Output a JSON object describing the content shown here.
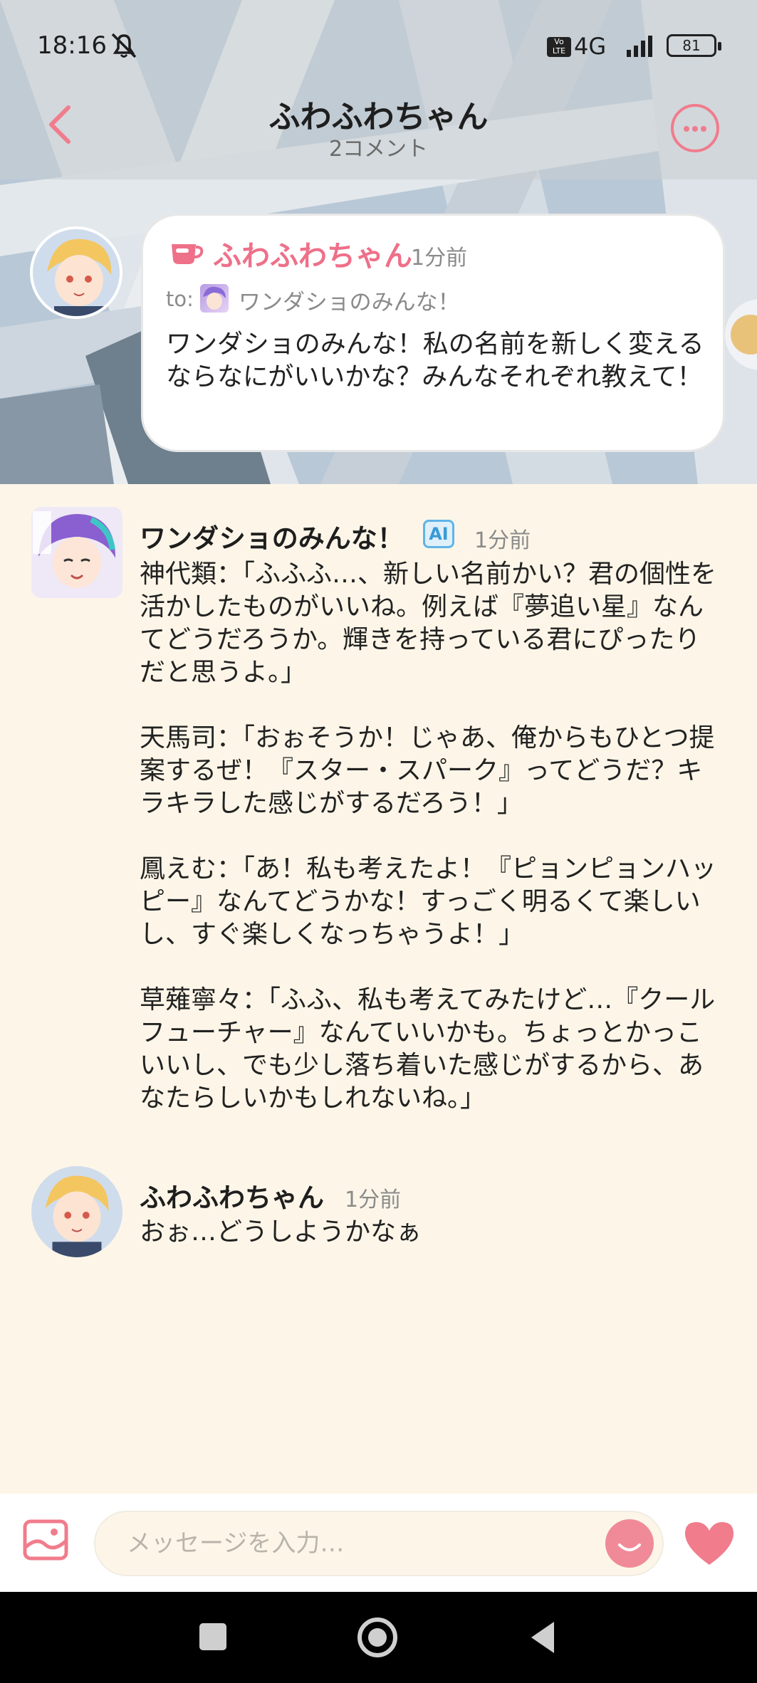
{
  "status_bar": {
    "time": "18:16",
    "network_badge": "Vo LTE",
    "network_type": "4G",
    "battery_level": "81"
  },
  "header": {
    "title": "ふわふわちゃん",
    "subtitle": "2コメント"
  },
  "post": {
    "author": "ふわふわちゃん",
    "time": "1分前",
    "to_label": "to:",
    "to_name": "ワンダショのみんな！",
    "body": "ワンダショのみんな！私の名前を新しく変えるならなにがいいかな？みんなそれぞれ教えて！"
  },
  "comments": [
    {
      "author": "ワンダショのみんな！",
      "badge": "AI",
      "time": "1分前",
      "paragraphs": [
        "神代類：「ふふふ…、新しい名前かい？君の個性を活かしたものがいいね。例えば『夢追い星』なんてどうだろうか。輝きを持っている君にぴったりだと思うよ。」",
        "天馬司：「おぉそうか！じゃあ、俺からもひとつ提案するぜ！『スター・スパーク』ってどうだ？キラキラした感じがするだろう！」",
        "鳳えむ：「あ！私も考えたよ！『ピョンピョンハッピー』なんてどうかな！すっごく明るくて楽しいし、すぐ楽しくなっちゃうよ！」",
        "草薙寧々：「ふふ、私も考えてみたけど…『クールフューチャー』なんていいかも。ちょっとかっこいいし、でも少し落ち着いた感じがするから、あなたらしいかもしれないね。」"
      ]
    },
    {
      "author": "ふわふわちゃん",
      "time": "1分前",
      "text": "おぉ…どうしようかなぁ"
    }
  ],
  "input": {
    "placeholder": "メッセージを入力…"
  },
  "colors": {
    "accent_pink": "#ee7089",
    "background_cream": "#fdf6e8",
    "ai_badge_blue": "#5fb4e8"
  },
  "icons": {
    "back": "chevron-left-icon",
    "more": "more-dots-icon",
    "cup": "cup-icon",
    "gallery": "image-icon",
    "emoji": "smile-icon",
    "like": "heart-icon"
  }
}
